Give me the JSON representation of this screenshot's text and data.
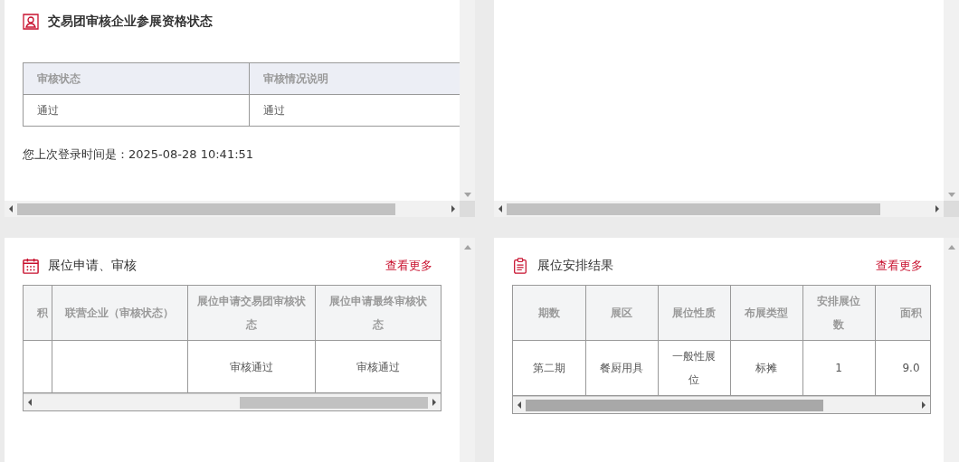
{
  "panels": [
    {
      "kind": "status",
      "title": "交易团审核企业参展资格状态",
      "table": {
        "columns": [
          "审核状态",
          "审核情况说明"
        ],
        "rows": [
          [
            "通过",
            "通过"
          ]
        ]
      },
      "login_note": "您上次登录时间是：2025-08-28 10:41:51"
    },
    {
      "kind": "empty"
    },
    {
      "kind": "grid",
      "title": "展位申请、审核",
      "more_link": "查看更多",
      "table": {
        "columns": [
          "积",
          "联营企业（审核状态）",
          "展位申请交易团审核状态",
          "展位申请最终审核状态"
        ],
        "rows": [
          [
            null,
            null,
            "审核通过",
            "审核通过"
          ]
        ]
      }
    },
    {
      "kind": "grid",
      "title": "展位安排结果",
      "more_link": "查看更多",
      "table": {
        "columns": [
          "期数",
          "展区",
          "展位性质",
          "布展类型",
          "安排展位数",
          "面积"
        ],
        "rows": [
          [
            "第二期",
            "餐厨用具",
            "一般性展位",
            "标摊",
            "1",
            "9.0"
          ]
        ]
      }
    }
  ]
}
